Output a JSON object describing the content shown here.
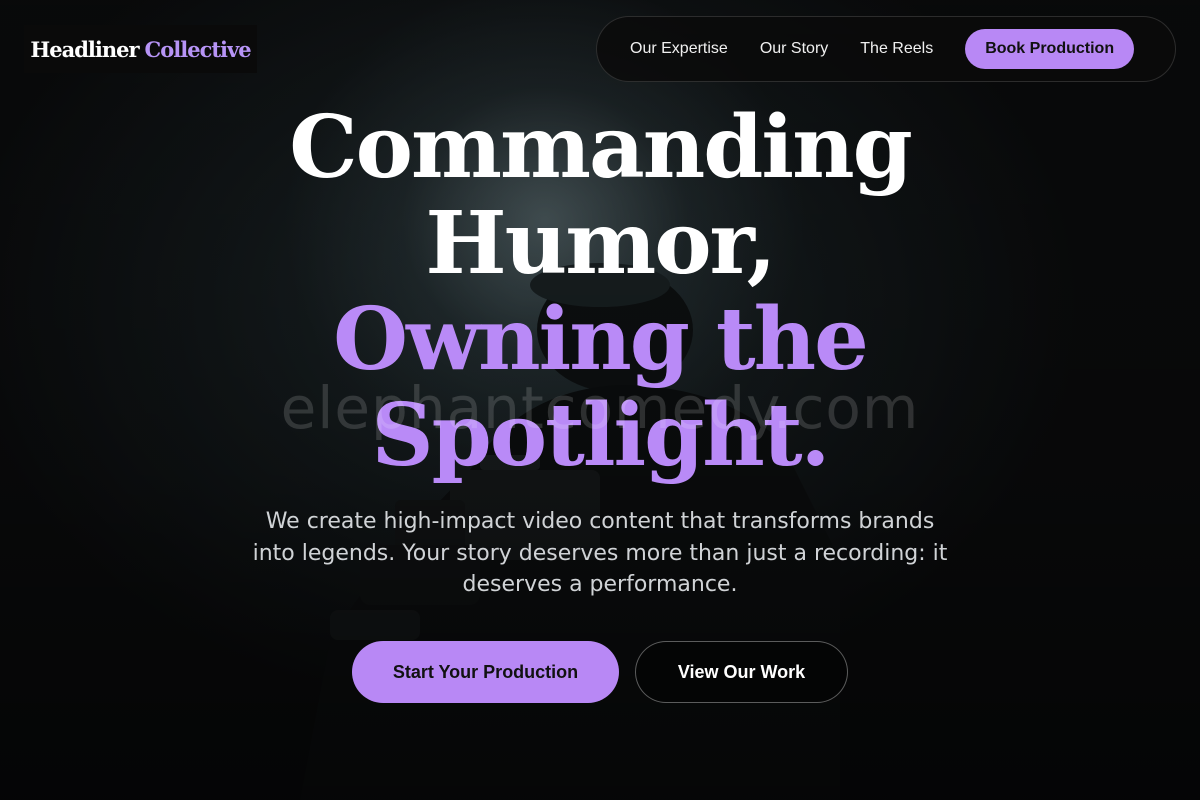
{
  "brand": {
    "name_part1": "Headliner",
    "name_part2": "Collective",
    "accent_color": "#b888f5"
  },
  "nav": {
    "items": [
      {
        "label": "Our Expertise"
      },
      {
        "label": "Our Story"
      },
      {
        "label": "The Reels"
      }
    ],
    "cta_label": "Book Production"
  },
  "hero": {
    "headline_line1": "Commanding",
    "headline_line2": "Humor,",
    "headline_line3": "Owning the",
    "headline_line4": "Spotlight.",
    "watermark": "elephantcomedy.com",
    "subtext": "We create high-impact video content that transforms brands into legends. Your story deserves more than just a recording: it deserves a performance.",
    "primary_cta": "Start Your Production",
    "secondary_cta": "View Our Work",
    "background_image": "camera-operator-silhouette"
  }
}
